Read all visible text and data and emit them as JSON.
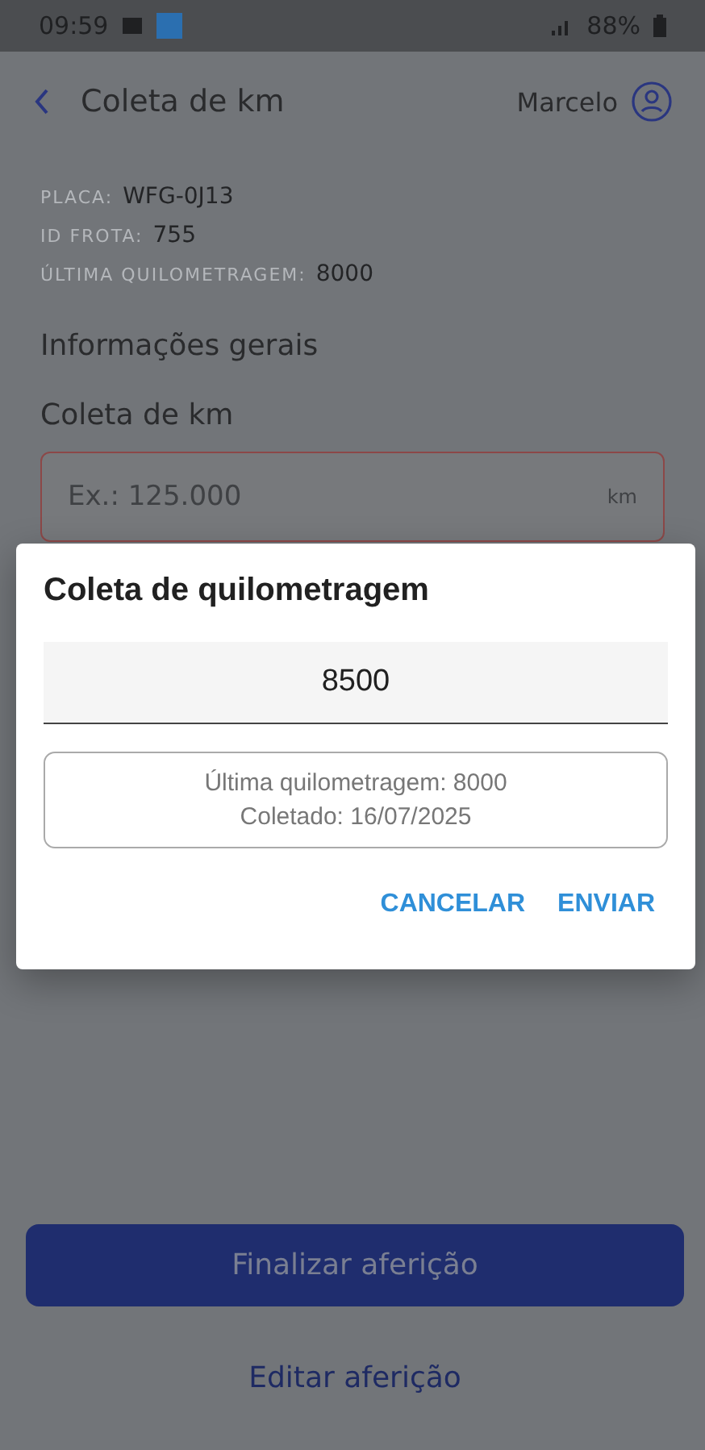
{
  "status_bar": {
    "time": "09:59",
    "battery": "88%"
  },
  "header": {
    "title": "Coleta de km",
    "user": "Marcelo"
  },
  "vehicle_info": [
    {
      "label": "PLACA:",
      "value": "WFG-0J13"
    },
    {
      "label": "ID FROTA:",
      "value": "755"
    },
    {
      "label": "ÚLTIMA QUILOMETRAGEM:",
      "value": "8000"
    }
  ],
  "section_title": "Informações gerais",
  "field": {
    "label": "Coleta de km",
    "placeholder": "Ex.: 125.000",
    "unit": "km",
    "error": true
  },
  "dialog": {
    "title": "Coleta de quilometragem",
    "value": "8500",
    "info": [
      "Última quilometragem: 8000",
      "Coletado: 16/07/2025"
    ],
    "buttons": [
      "CANCELAR",
      "ENVIAR"
    ]
  },
  "primary_button": {
    "label": "Finalizar aferição",
    "disabled": true
  },
  "link": "Editar aferição"
}
